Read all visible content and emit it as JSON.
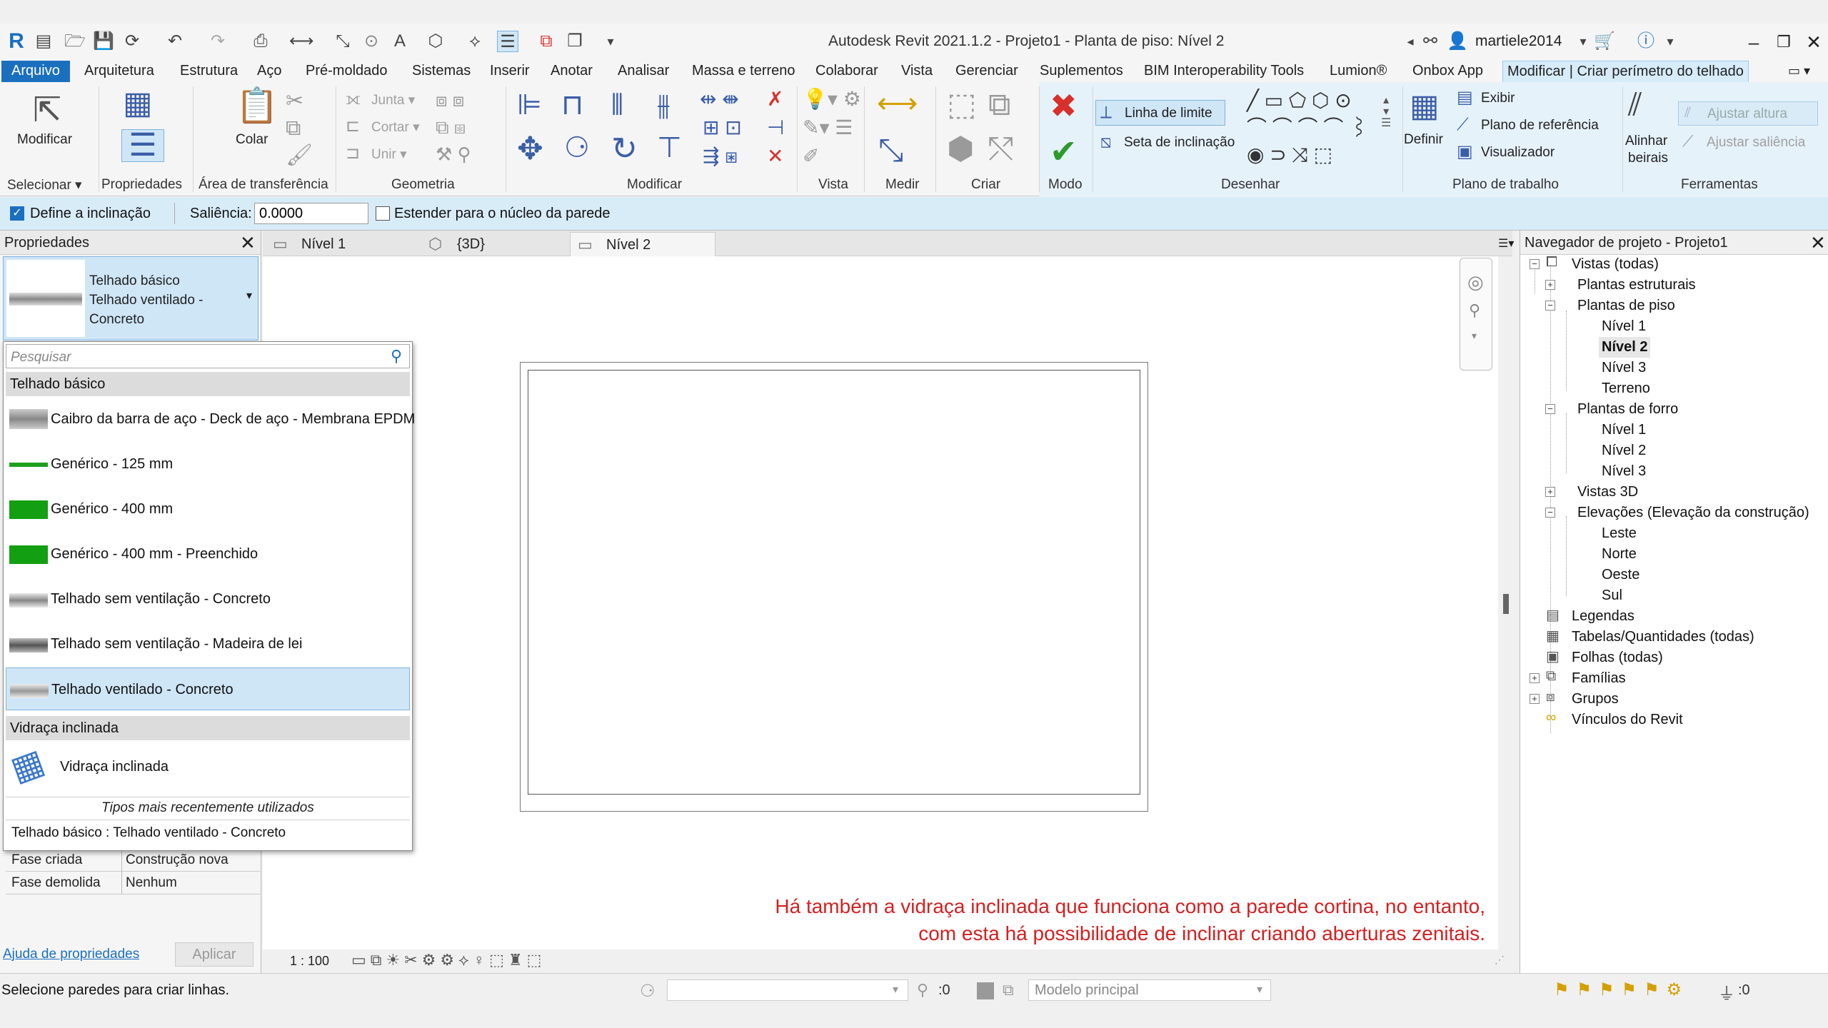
{
  "window": {
    "title": "Autodesk Revit 2021.1.2 - Projeto1 - Planta de piso: Nível 2",
    "user": "martiele2014"
  },
  "menu_tabs": [
    "Arquivo",
    "Arquitetura",
    "Estrutura",
    "Aço",
    "Pré-moldado",
    "Sistemas",
    "Inserir",
    "Anotar",
    "Analisar",
    "Massa e terreno",
    "Colaborar",
    "Vista",
    "Gerenciar",
    "Suplementos",
    "BIM Interoperability Tools",
    "Lumion®",
    "Onbox App",
    "Modificar | Criar perímetro do telhado"
  ],
  "ribbon": {
    "modificar_label": "Modificar",
    "colar_label": "Colar",
    "junta": "Junta",
    "cortar": "Cortar",
    "unir": "Unir",
    "linha_de_limite": "Linha de limite",
    "seta_de_inclinacao": "Seta de inclinação",
    "exibir": "Exibir",
    "plano_de_referencia": "Plano de  referência",
    "visualizador": "Visualizador",
    "definir": "Definir",
    "alinhar": "Alinhar",
    "beirais": "beirais",
    "ajustar_altura": "Ajustar  altura",
    "ajustar_saliencia": "Ajustar  saliência",
    "panels": {
      "selecionar": "Selecionar",
      "propriedades": "Propriedades",
      "transferencia": "Área de transferência",
      "geometria": "Geometria",
      "modificar": "Modificar",
      "vista": "Vista",
      "medir": "Medir",
      "criar": "Criar",
      "modo": "Modo",
      "desenhar": "Desenhar",
      "plano_de_trabalho": "Plano de trabalho",
      "ferramentas": "Ferramentas"
    }
  },
  "options_bar": {
    "define_inclinacao": "Define a inclinação",
    "define_inclinacao_checked": true,
    "saliencia_label": "Saliência:",
    "saliencia_value": "0.0000",
    "estender_label": "Estender para o núcleo da parede",
    "estender_checked": false
  },
  "properties": {
    "title": "Propriedades",
    "family": "Telhado básico",
    "type_line1": "Telhado ventilado -",
    "type_line2": "Concreto",
    "rows": [
      {
        "key": "Fase criada",
        "value": "Construção nova"
      },
      {
        "key": "Fase demolida",
        "value": "Nenhum"
      }
    ],
    "help_link": "Ajuda de propriedades",
    "apply": "Aplicar"
  },
  "type_dropdown": {
    "search_placeholder": "Pesquisar",
    "group1": "Telhado básico",
    "items": [
      {
        "label": "Caibro da barra de aço - Deck de aço - Membrana EPDM",
        "swatch": "#9a9a9a"
      },
      {
        "label": "Genérico - 125 mm",
        "swatch": "#1ea01e"
      },
      {
        "label": "Genérico - 400 mm",
        "swatch": "#1ea01e"
      },
      {
        "label": "Genérico - 400 mm - Preenchido",
        "swatch": "#1ea01e"
      },
      {
        "label": "Telhado sem ventilação - Concreto",
        "swatch": "#a8a8a8"
      },
      {
        "label": "Telhado sem ventilação - Madeira de lei",
        "swatch": "#777777"
      },
      {
        "label": "Telhado ventilado - Concreto",
        "swatch": "#b0b0b0"
      }
    ],
    "group2": "Vidraça inclinada",
    "glazing_item": "Vidraça inclinada",
    "recent_header": "Tipos mais recentemente utilizados",
    "recent_item": "Telhado básico : Telhado ventilado - Concreto"
  },
  "view_tabs": [
    "Nível 1",
    "{3D}",
    "Nível 2"
  ],
  "canvas": {
    "note_line1": "Há também a vidraça inclinada que funciona como a parede cortina, no entanto,",
    "note_line2": "com esta há possibilidade de inclinar criando aberturas zenitais.",
    "scale": "1 : 100"
  },
  "browser": {
    "title": "Navegador de projeto - Projeto1",
    "views_all": "Vistas (todas)",
    "plantas_estruturais": "Plantas estruturais",
    "plantas_de_piso": "Plantas de piso",
    "piso_items": [
      "Nível 1",
      "Nível 2",
      "Nível 3",
      "Terreno"
    ],
    "plantas_de_forro": "Plantas de forro",
    "forro_items": [
      "Nível 1",
      "Nível 2",
      "Nível 3"
    ],
    "vistas_3d": "Vistas 3D",
    "elevacoes": "Elevações (Elevação da construção)",
    "elev_items": [
      "Leste",
      "Norte",
      "Oeste",
      "Sul"
    ],
    "legendas": "Legendas",
    "tabelas": "Tabelas/Quantidades (todas)",
    "folhas": "Folhas (todas)",
    "familias": "Famílias",
    "grupos": "Grupos",
    "vinculos": "Vínculos do Revit"
  },
  "status": {
    "message": "Selecione paredes para criar linhas.",
    "zero1": ":0",
    "model": "Modelo principal",
    "filter_count": ":0"
  }
}
